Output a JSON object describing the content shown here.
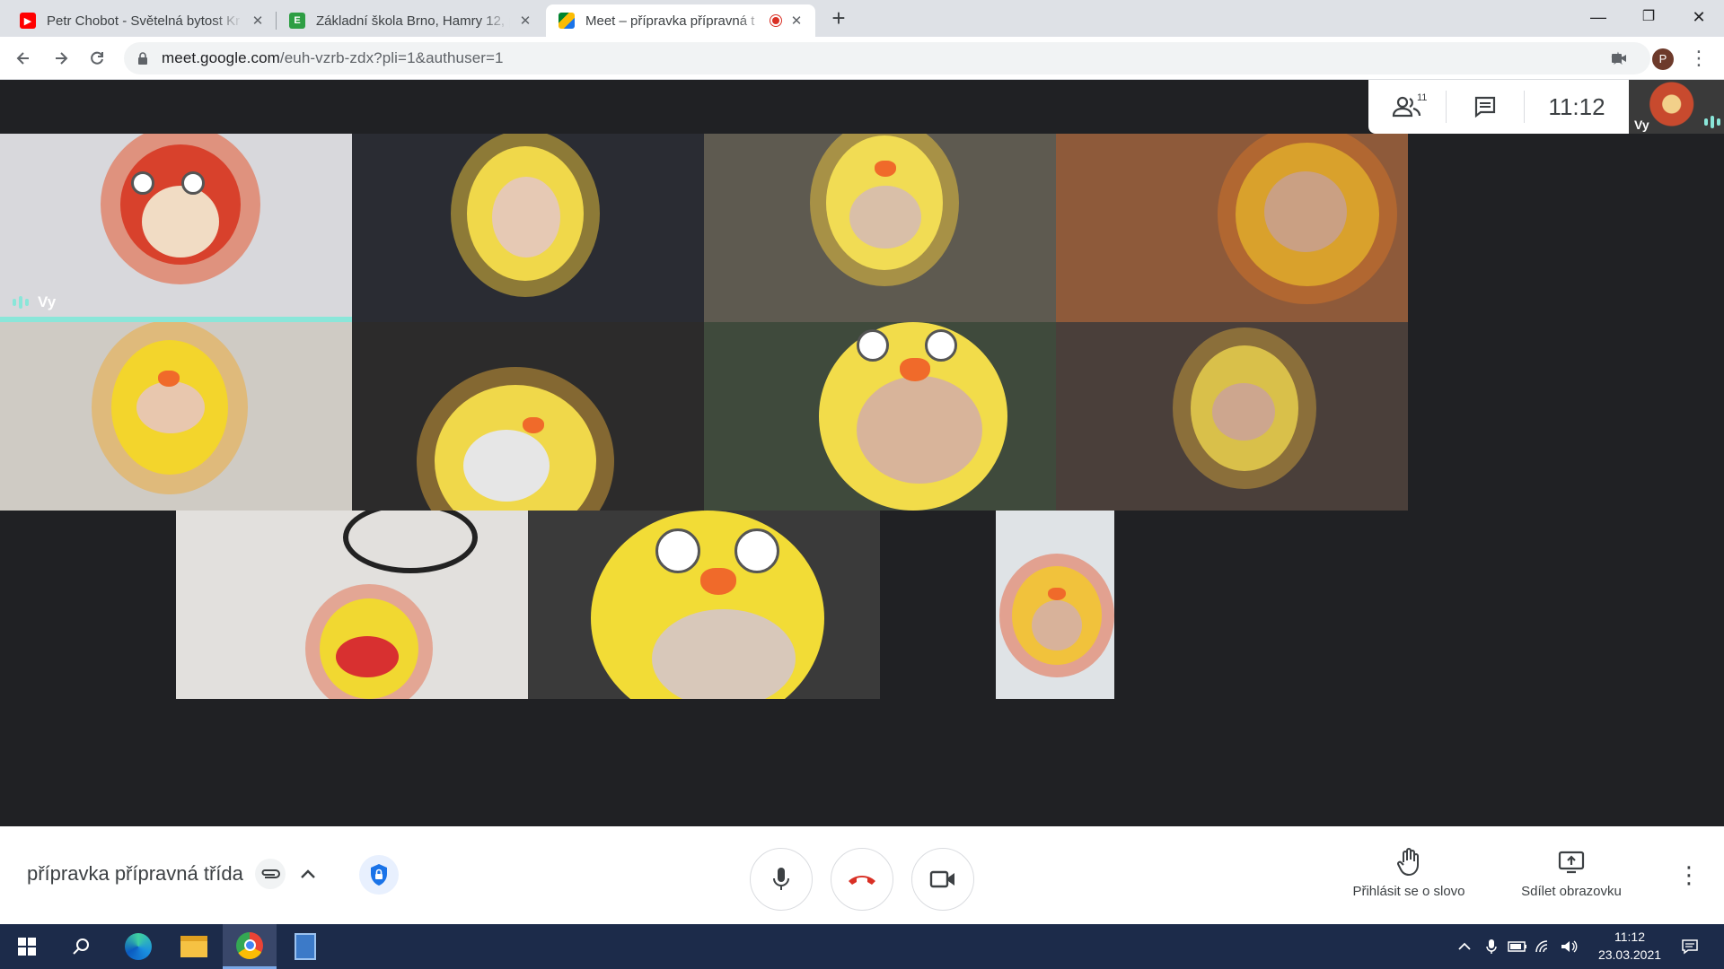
{
  "browser": {
    "tabs": [
      {
        "title": "Petr Chobot - Světelná bytost Kr",
        "favicon": "youtube-icon",
        "active": false
      },
      {
        "title": "Základní škola Brno, Hamry 12, p",
        "favicon": "edookit-icon",
        "active": false
      },
      {
        "title": "Meet – přípravka přípravná t",
        "favicon": "meet-icon",
        "active": true
      }
    ],
    "url_host": "meet.google.com",
    "url_path": "/euh-vzrb-zdx?pli=1&authuser=1",
    "profile_initial": "P"
  },
  "meet": {
    "participants_count": "11",
    "clock": "11:12",
    "self_label": "Vy",
    "tile_self_label": "Vy",
    "meeting_name": "přípravka přípravná třída",
    "raise_hand_label": "Přihlásit se o slovo",
    "present_label": "Sdílet obrazovku"
  },
  "taskbar": {
    "time": "11:12",
    "date": "23.03.2021"
  },
  "colors": {
    "meet_bg": "#202124",
    "speaking": "#8ae6d9",
    "hangup": "#d93025",
    "taskbar": "#1c2b4a"
  }
}
